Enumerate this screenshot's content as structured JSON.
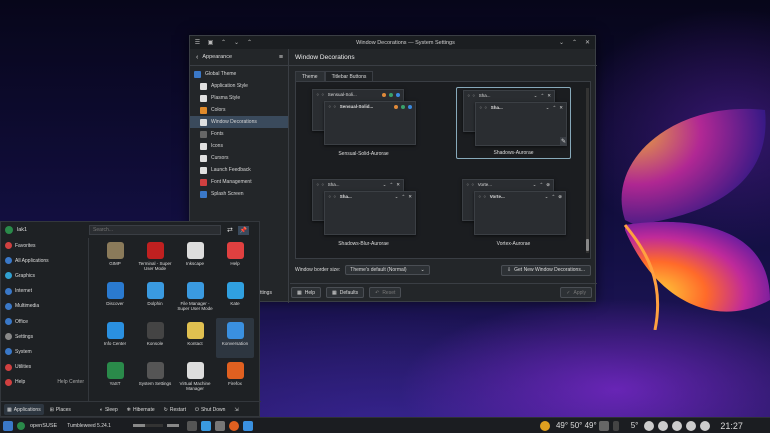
{
  "window": {
    "title": "Window Decorations — System Settings",
    "header_title": "Window Decorations",
    "back_label": "Appearance"
  },
  "sidebar": {
    "items": [
      {
        "label": "Global Theme",
        "icon": "globe-icon",
        "color": "#3a78c8"
      },
      {
        "label": "Application Style",
        "icon": "brush-icon",
        "color": "#e0e0e0"
      },
      {
        "label": "Plasma Style",
        "icon": "plasma-icon",
        "color": "#e0e0e0"
      },
      {
        "label": "Colors",
        "icon": "palette-icon",
        "color": "#e08a2a"
      },
      {
        "label": "Window Decorations",
        "icon": "window-icon",
        "color": "#e0e0e0"
      },
      {
        "label": "Fonts",
        "icon": "fonts-icon",
        "color": "#666"
      },
      {
        "label": "Icons",
        "icon": "icons-icon",
        "color": "#e0e0e0"
      },
      {
        "label": "Cursors",
        "icon": "cursor-icon",
        "color": "#e0e0e0"
      },
      {
        "label": "Launch Feedback",
        "icon": "launch-icon",
        "color": "#e0e0e0"
      },
      {
        "label": "Font Management",
        "icon": "fontmgmt-icon",
        "color": "#d04040"
      },
      {
        "label": "Splash Screen",
        "icon": "splash-icon",
        "color": "#3a78c8"
      }
    ]
  },
  "tabs": [
    "Theme",
    "Titlebar Buttons"
  ],
  "decorations": [
    {
      "label": "Sensual-Solid-Aurorae",
      "win1": "Sensual-Soli...",
      "win2": "Sensual-Solid..."
    },
    {
      "label": "Shadows-Aurorae",
      "win1": "Sha...",
      "win2": "Sha..."
    },
    {
      "label": "Shadows-Blur-Aurorae",
      "win1": "Sha...",
      "win2": "Sha..."
    },
    {
      "label": "Vortex-Aurorae",
      "win1": "Vorte...",
      "win2": "Vorte..."
    }
  ],
  "border": {
    "label": "Window border size:",
    "value": "Theme's default (Normal)",
    "get_new": "Get New Window Decorations..."
  },
  "footer": {
    "help": "Help",
    "defaults": "Defaults",
    "reset": "Reset",
    "apply": "Apply",
    "settings_fragment": "ttings"
  },
  "launcher": {
    "user": "lak1",
    "search_placeholder": "Search...",
    "categories": [
      {
        "label": "Favorites",
        "color": "#d04040"
      },
      {
        "label": "All Applications",
        "color": "#3a78c8"
      },
      {
        "label": "Graphics",
        "color": "#30a0d0"
      },
      {
        "label": "Internet",
        "color": "#3a78c8"
      },
      {
        "label": "Multimedia",
        "color": "#3a78c8"
      },
      {
        "label": "Office",
        "color": "#3a78c8"
      },
      {
        "label": "Settings",
        "color": "#888"
      },
      {
        "label": "System",
        "color": "#3a78c8"
      },
      {
        "label": "Utilities",
        "color": "#d04040"
      },
      {
        "label": "Help",
        "color": "#d04040"
      }
    ],
    "help_center": "Help Center",
    "apps": [
      {
        "label": "GIMP",
        "color": "#8a7a5a"
      },
      {
        "label": "Terminal - Super User Mode",
        "color": "#c02020"
      },
      {
        "label": "Inkscape",
        "color": "#ddd"
      },
      {
        "label": "Help",
        "color": "#e04040"
      },
      {
        "label": "Discover",
        "color": "#2a7ad0"
      },
      {
        "label": "Dolphin",
        "color": "#3a9ae0"
      },
      {
        "label": "File Manager - Super User Mode",
        "color": "#3a9ae0"
      },
      {
        "label": "Kate",
        "color": "#30a0e0"
      },
      {
        "label": "Info Center",
        "color": "#2a90e0"
      },
      {
        "label": "Konsole",
        "color": "#444"
      },
      {
        "label": "Kontact",
        "color": "#e0c050"
      },
      {
        "label": "Konversation",
        "color": "#3a90e0"
      },
      {
        "label": "YaST",
        "color": "#2a8a4a"
      },
      {
        "label": "System Settings",
        "color": "#555"
      },
      {
        "label": "Virtual Machine Manager",
        "color": "#ddd"
      },
      {
        "label": "Firefox",
        "color": "#e06020"
      }
    ],
    "footer": {
      "applications": "Applications",
      "places": "Places",
      "sleep": "Sleep",
      "hibernate": "Hibernate",
      "restart": "Restart",
      "shutdown": "Shut Down"
    }
  },
  "taskbar": {
    "distro": "openSUSE",
    "version": "Tumbleweed 5.24.1",
    "temps": "49°  50°  49°",
    "weather": "5°",
    "clock": "21:27"
  }
}
